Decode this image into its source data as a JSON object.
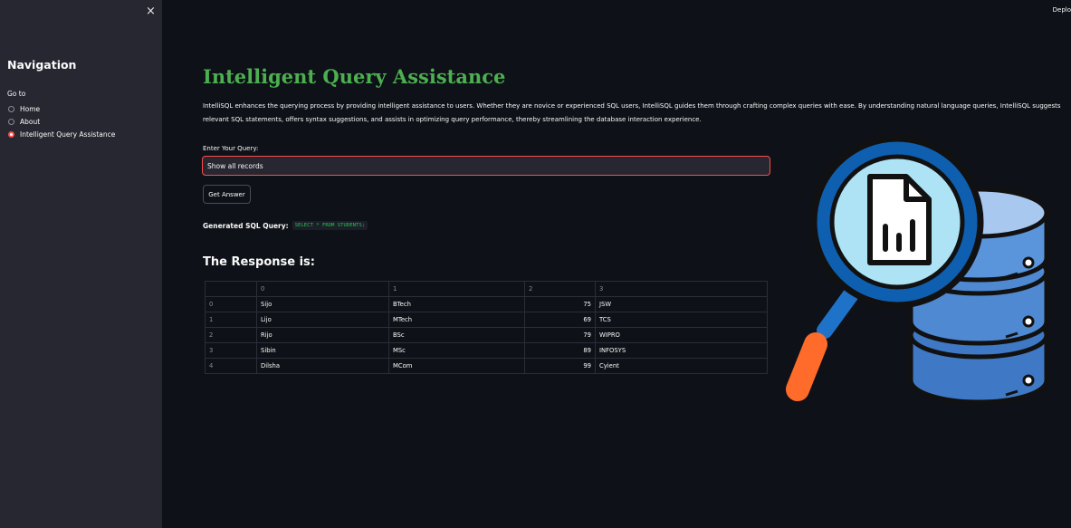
{
  "sidebar": {
    "close_icon": "×",
    "title": "Navigation",
    "goto_label": "Go to",
    "options": [
      {
        "label": "Home",
        "selected": false
      },
      {
        "label": "About",
        "selected": false
      },
      {
        "label": "Intelligent Query Assistance",
        "selected": true
      }
    ]
  },
  "header": {
    "deploy_label": "Deplo"
  },
  "main": {
    "title": "Intelligent Query Assistance",
    "description": "IntelliSQL enhances the querying process by providing intelligent assistance to users. Whether they are novice or experienced SQL users, IntelliSQL guides them through crafting complex queries with ease. By understanding natural language queries, IntelliSQL suggests relevant SQL statements, offers syntax suggestions, and assists in optimizing query performance, thereby streamlining the database interaction experience.",
    "query_label": "Enter Your Query:",
    "query_value": "Show all records",
    "button_label": "Get Answer",
    "generated_label": "Generated SQL Query:",
    "generated_sql": "SELECT * FROM STUDENTS;",
    "response_title": "The Response is:",
    "table": {
      "columns": [
        "",
        "0",
        "1",
        "2",
        "3"
      ],
      "rows": [
        [
          "0",
          "Sijo",
          "BTech",
          "75",
          "JSW"
        ],
        [
          "1",
          "Lijo",
          "MTech",
          "69",
          "TCS"
        ],
        [
          "2",
          "Rijo",
          "BSc",
          "79",
          "WIPRO"
        ],
        [
          "3",
          "Sibin",
          "MSc",
          "89",
          "INFOSYS"
        ],
        [
          "4",
          "Dilsha",
          "MCom",
          "99",
          "Cyient"
        ]
      ]
    }
  },
  "illustration": {
    "icon": "database-search-icon"
  },
  "colors": {
    "accent": "#ff4b4b",
    "title_green": "#4caf50",
    "background": "#0e1117",
    "sidebar": "#262730"
  }
}
